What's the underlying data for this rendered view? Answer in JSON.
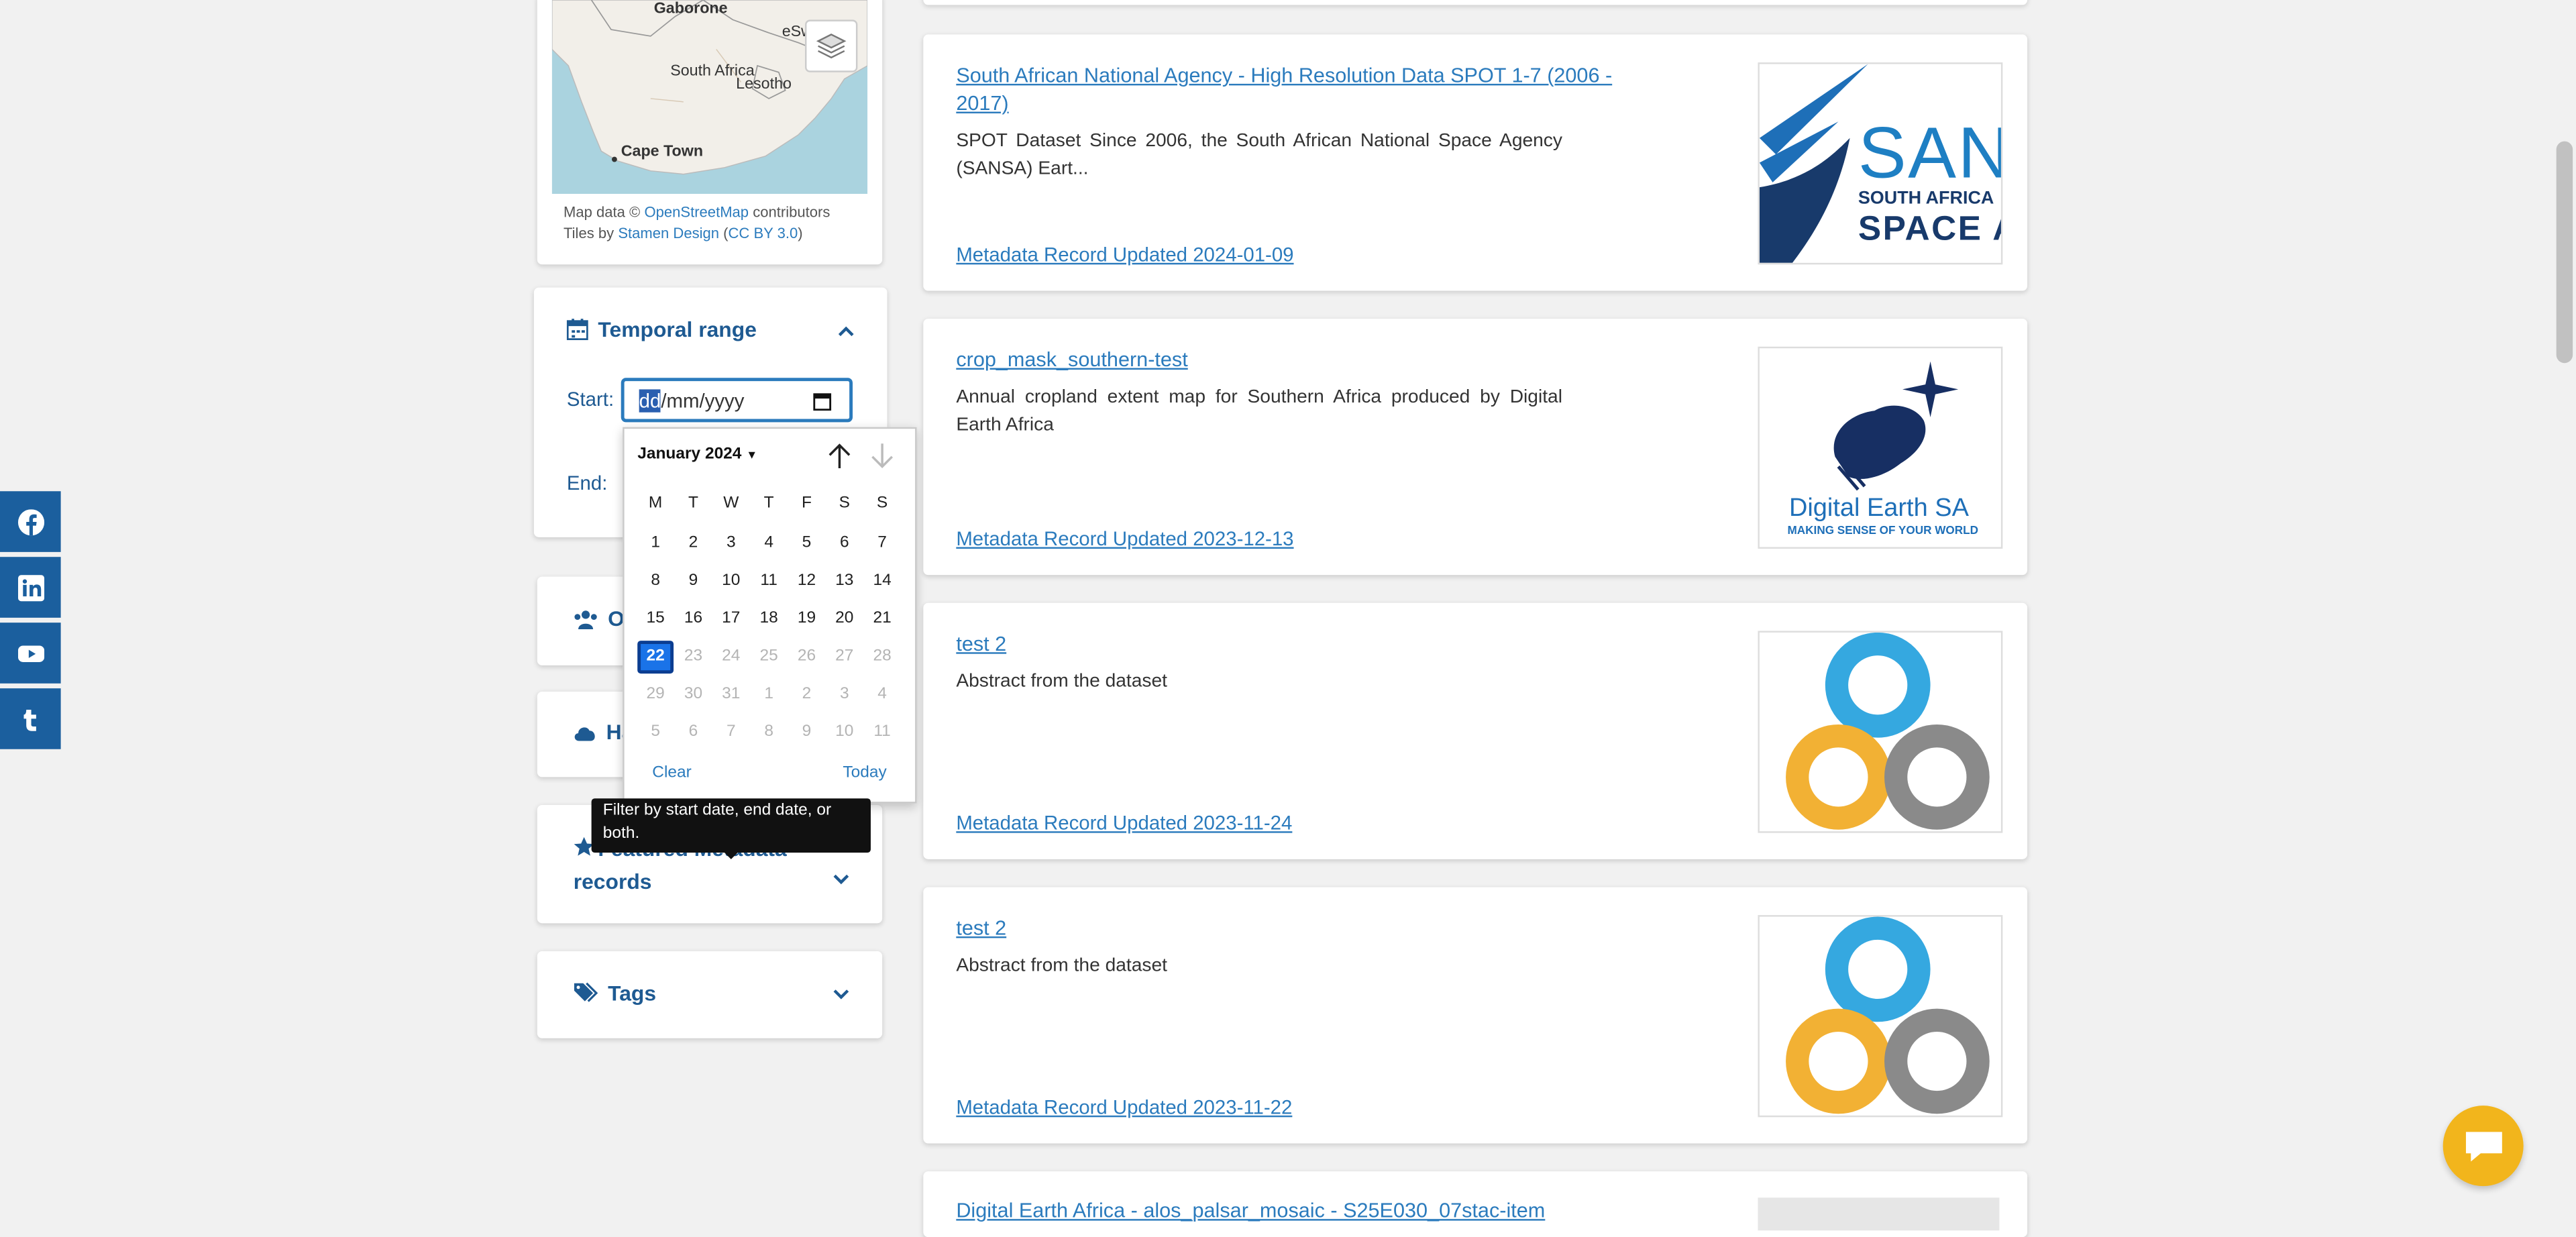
{
  "map": {
    "labels": [
      "Gaborone",
      "eSw",
      "South Africa",
      "Lesotho",
      "Cape Town"
    ],
    "credit_prefix": "Map data ©",
    "credit_link": "OpenStreetMap",
    "credit_suffix": "contributors",
    "tiles_prefix": "Tiles by",
    "tiles_link1": "Stamen Design",
    "tiles_link2": "CC BY 3.0"
  },
  "temporal": {
    "title": "Temporal range",
    "start_label": "Start:",
    "end_label": "End:",
    "start_value_highlight": "dd",
    "start_value_rest": "/mm/yyyy"
  },
  "datepicker": {
    "month": "January 2024",
    "weekdays": [
      "M",
      "T",
      "W",
      "T",
      "F",
      "S",
      "S"
    ],
    "rows": [
      [
        "1",
        "2",
        "3",
        "4",
        "5",
        "6",
        "7"
      ],
      [
        "8",
        "9",
        "10",
        "11",
        "12",
        "13",
        "14"
      ],
      [
        "15",
        "16",
        "17",
        "18",
        "19",
        "20",
        "21"
      ],
      [
        "22",
        "23",
        "24",
        "25",
        "26",
        "27",
        "28"
      ],
      [
        "29",
        "30",
        "31",
        "1",
        "2",
        "3",
        "4"
      ],
      [
        "5",
        "6",
        "7",
        "8",
        "9",
        "10",
        "11"
      ]
    ],
    "selected": "22",
    "clear": "Clear",
    "today": "Today"
  },
  "tooltip": "Filter by start date, end date, or both.",
  "panels": {
    "organisations_partial": "Or",
    "harvest_partial": "Ha",
    "featured": "Featured Metadata records",
    "tags": "Tags"
  },
  "results": [
    {
      "title": "South African National Agency - High Resolution Data SPOT 1-7 (2006 - 2017)",
      "abstract": "SPOT Dataset Since 2006, the South African National Space Agency (SANSA) Eart...",
      "updated": "Metadata Record Updated 2024-01-09",
      "logo_text": [
        "SAN",
        "SOUTH AFRICA",
        "SPACE A"
      ]
    },
    {
      "title": "crop_mask_southern-test",
      "abstract": "Annual cropland extent map for Southern Africa produced by Digital Earth Africa",
      "updated": "Metadata Record Updated 2023-12-13",
      "logo_text": [
        "Digital Earth SA",
        "MAKING SENSE OF YOUR WORLD"
      ]
    },
    {
      "title": "test 2",
      "abstract": "Abstract from the dataset",
      "updated": "Metadata Record Updated 2023-11-24"
    },
    {
      "title": "test 2",
      "abstract": "Abstract from the dataset",
      "updated": "Metadata Record Updated 2023-11-22"
    },
    {
      "title": "Digital Earth Africa - alos_palsar_mosaic - S25E030_07stac-item"
    }
  ],
  "colors": {
    "brand": "#1e5a92",
    "link": "#2b7bbd",
    "social": "#1b5f9e",
    "chat": "#f2b51c"
  }
}
